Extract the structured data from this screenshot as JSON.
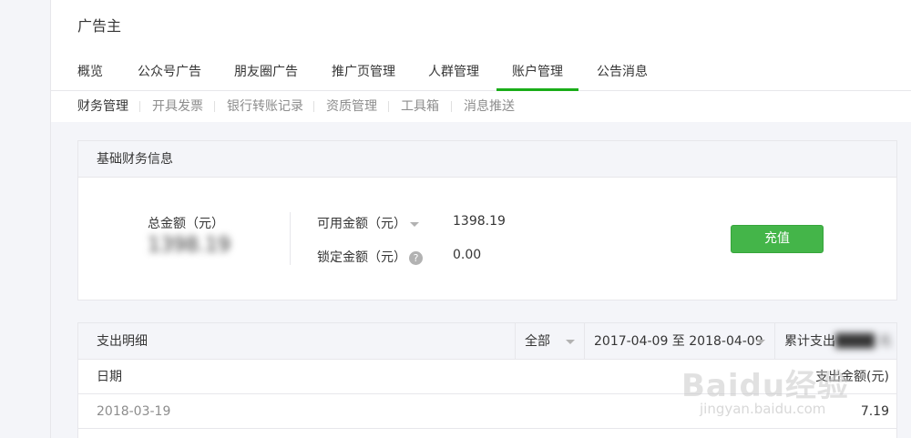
{
  "app": {
    "brand": "广告主"
  },
  "main_nav": [
    {
      "label": "概览"
    },
    {
      "label": "公众号广告"
    },
    {
      "label": "朋友圈广告"
    },
    {
      "label": "推广页管理"
    },
    {
      "label": "人群管理"
    },
    {
      "label": "账户管理",
      "active": true
    },
    {
      "label": "公告消息"
    }
  ],
  "sub_nav": [
    {
      "label": "财务管理",
      "active": true
    },
    {
      "label": "开具发票"
    },
    {
      "label": "银行转账记录"
    },
    {
      "label": "资质管理"
    },
    {
      "label": "工具箱"
    },
    {
      "label": "消息推送"
    }
  ],
  "finance": {
    "title": "基础财务信息",
    "total_label": "总金额（元）",
    "total_value": "1398.19",
    "available_label": "可用金额（元）",
    "available_value": "1398.19",
    "locked_label": "锁定金额（元）",
    "locked_value": "0.00",
    "help_icon": "?",
    "recharge_button": "充值"
  },
  "expense": {
    "title": "支出明细",
    "filter_type": "全部",
    "date_range": "2017-04-09 至 2018-04-09",
    "cumulative_label": "累计支出",
    "col_date": "日期",
    "col_amount": "支出金额(元)",
    "rows": [
      {
        "date": "2018-03-19",
        "amount": "7.19"
      }
    ]
  },
  "watermark": {
    "main": "Baidu经验",
    "sub": "jingyan.baidu.com"
  },
  "colors": {
    "accent": "#1aad19",
    "button": "#44b549"
  }
}
